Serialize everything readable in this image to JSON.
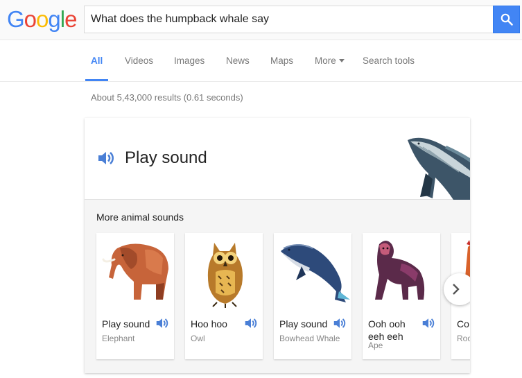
{
  "logo": {
    "letters": [
      "G",
      "o",
      "o",
      "g",
      "l",
      "e"
    ]
  },
  "search": {
    "query": "What does the humpback whale say"
  },
  "tabs": [
    {
      "label": "All",
      "active": true
    },
    {
      "label": "Videos"
    },
    {
      "label": "Images"
    },
    {
      "label": "News"
    },
    {
      "label": "Maps"
    },
    {
      "label": "More"
    },
    {
      "label": "Search tools"
    }
  ],
  "stats": {
    "text": "About 5,43,000 results (0.61 seconds)"
  },
  "card": {
    "play_label": "Play sound",
    "more_title": "More animal sounds",
    "animals": [
      {
        "name": "Play sound",
        "sub": "Elephant"
      },
      {
        "name": "Hoo hoo",
        "sub": "Owl"
      },
      {
        "name": "Play sound",
        "sub": "Bowhead Whale"
      },
      {
        "name": "Ooh ooh eeh eeh",
        "sub": "Ape"
      },
      {
        "name": "Co doo",
        "sub": "Roo"
      }
    ]
  },
  "colors": {
    "accent": "#4285f4",
    "speaker": "#4a7fd6"
  }
}
